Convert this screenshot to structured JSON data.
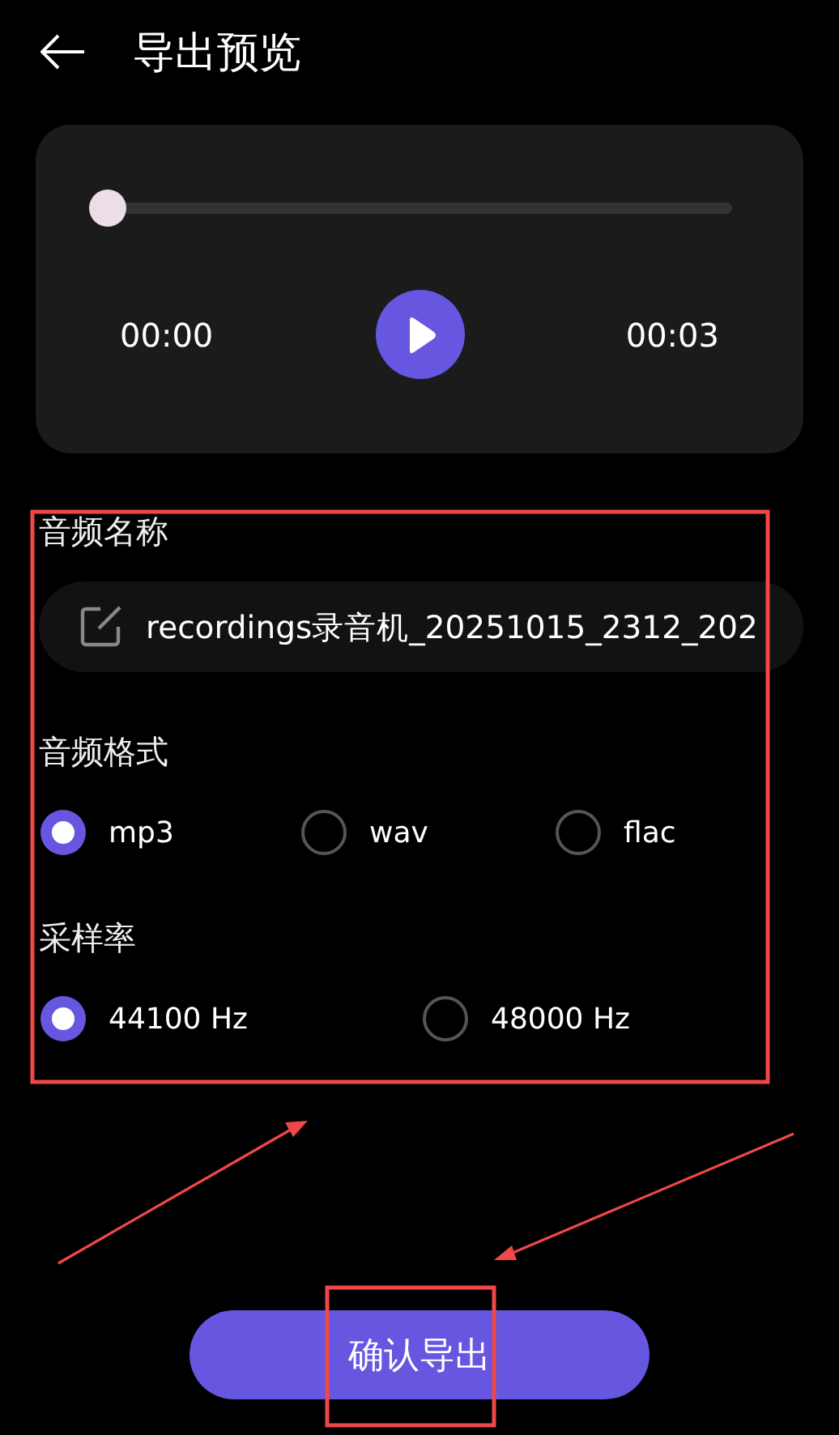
{
  "header": {
    "title": "导出预览"
  },
  "player": {
    "level": 0,
    "current_time": "00:00",
    "total_time": "00:03",
    "playing": false
  },
  "name_section": {
    "label": "音频名称",
    "value": "recordings录音机_20251015_2312_202"
  },
  "format_section": {
    "label": "音频格式",
    "options": [
      {
        "label": "mp3",
        "selected": true
      },
      {
        "label": "wav",
        "selected": false
      },
      {
        "label": "flac",
        "selected": false
      }
    ]
  },
  "sample_rate_section": {
    "label": "采样率",
    "options": [
      {
        "label": "44100 Hz",
        "selected": true
      },
      {
        "label": "48000 Hz",
        "selected": false
      }
    ]
  },
  "confirm_button": {
    "label": "确认导出"
  }
}
